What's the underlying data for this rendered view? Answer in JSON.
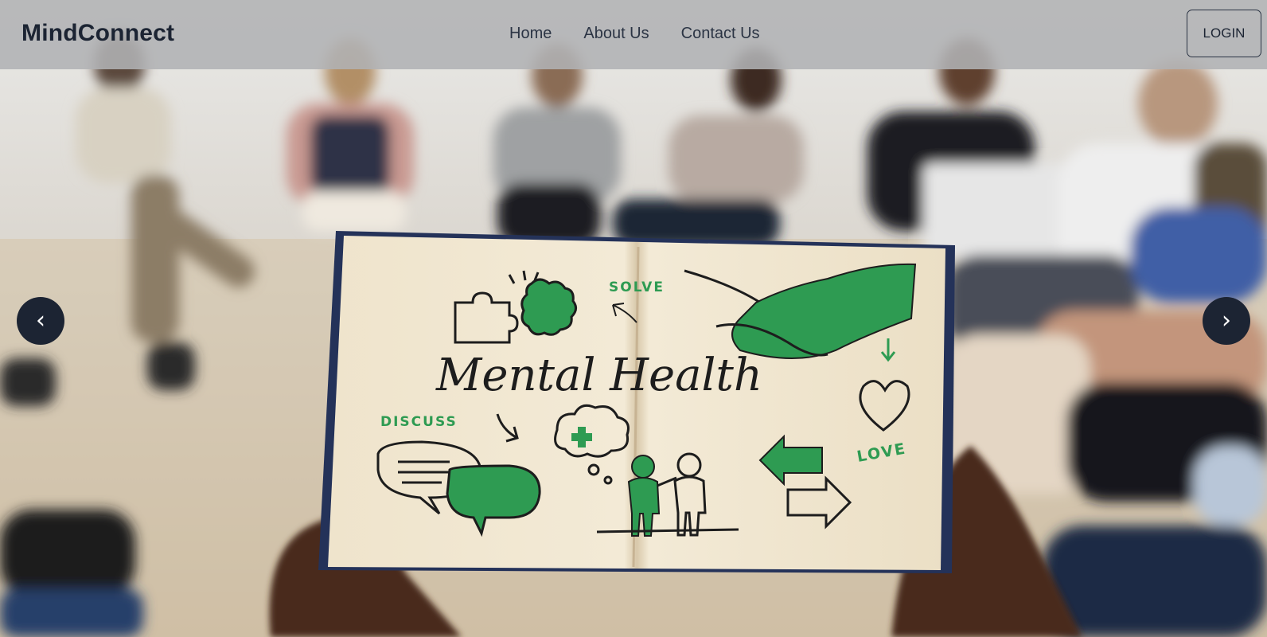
{
  "header": {
    "brand": "MindConnect",
    "nav": [
      {
        "label": "Home"
      },
      {
        "label": "About Us"
      },
      {
        "label": "Contact Us"
      }
    ],
    "login_label": "LOGIN"
  },
  "carousel": {
    "prev_icon": "chevron-left-icon",
    "next_icon": "chevron-right-icon",
    "prev_glyph": "‹",
    "next_glyph": "›",
    "slide": {
      "book_title": "Mental Health",
      "labels": {
        "solve": "SOLVE",
        "discuss": "DISCUSS",
        "love": "LOVE"
      }
    }
  },
  "colors": {
    "navbar": "#b0b2b4",
    "brand_text": "#1c2433",
    "arrow_bg": "#1c2433",
    "accent_green": "#2e9b52"
  }
}
